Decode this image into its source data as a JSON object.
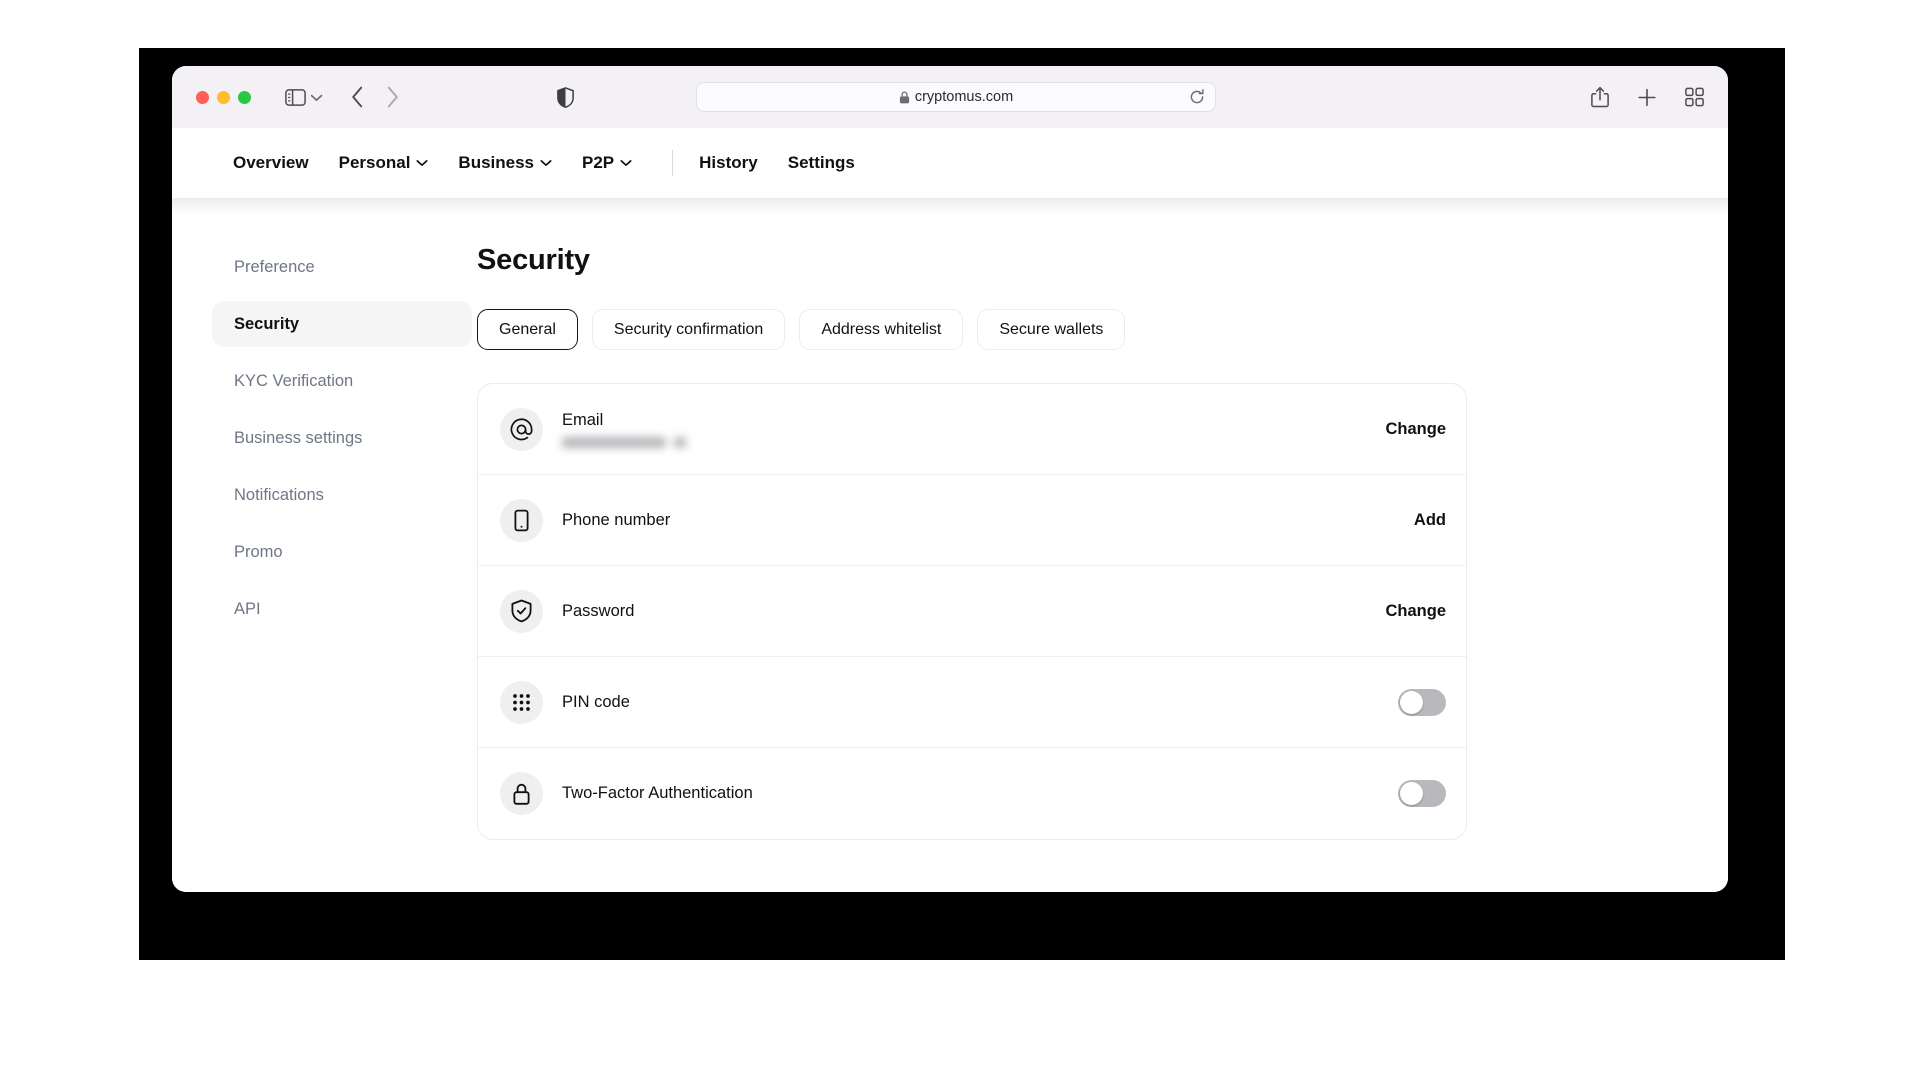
{
  "browser": {
    "traffic_lights": [
      "close",
      "minimize",
      "maximize"
    ],
    "url": "cryptomus.com",
    "lock_icon": "lock-icon",
    "sidebar_icon": "sidebar-toggle-icon",
    "tabgroup_caret_icon": "chevron-down-icon",
    "back_icon": "chevron-left-icon",
    "forward_icon": "chevron-right-icon",
    "shield_icon": "privacy-shield-icon",
    "reload_icon": "reload-icon",
    "share_icon": "share-icon",
    "new_tab_icon": "plus-icon",
    "tab_overview_icon": "tab-overview-icon"
  },
  "site_nav": {
    "items": [
      {
        "label": "Overview",
        "has_caret": false
      },
      {
        "label": "Personal",
        "has_caret": true
      },
      {
        "label": "Business",
        "has_caret": true
      },
      {
        "label": "P2P",
        "has_caret": true
      }
    ],
    "items_right": [
      {
        "label": "History",
        "has_caret": false
      },
      {
        "label": "Settings",
        "has_caret": false
      }
    ]
  },
  "sidebar": {
    "items": [
      {
        "label": "Preference",
        "active": false
      },
      {
        "label": "Security",
        "active": true
      },
      {
        "label": "KYC Verification",
        "active": false
      },
      {
        "label": "Business settings",
        "active": false
      },
      {
        "label": "Notifications",
        "active": false
      },
      {
        "label": "Promo",
        "active": false
      },
      {
        "label": "API",
        "active": false
      }
    ]
  },
  "main": {
    "title": "Security",
    "tabs": [
      {
        "label": "General",
        "active": true
      },
      {
        "label": "Security confirmation",
        "active": false
      },
      {
        "label": "Address whitelist",
        "active": false
      },
      {
        "label": "Secure wallets",
        "active": false
      }
    ],
    "rows": [
      {
        "label": "Email",
        "icon": "at-sign-icon",
        "action": "Change",
        "control": "link",
        "value_redacted": true
      },
      {
        "label": "Phone number",
        "icon": "phone-icon",
        "action": "Add",
        "control": "link",
        "value_redacted": false
      },
      {
        "label": "Password",
        "icon": "shield-check-icon",
        "action": "Change",
        "control": "link",
        "value_redacted": false
      },
      {
        "label": "PIN code",
        "icon": "keypad-dots-icon",
        "action": "",
        "control": "toggle",
        "toggle_on": false
      },
      {
        "label": "Two-Factor Authentication",
        "icon": "padlock-icon",
        "action": "",
        "control": "toggle",
        "toggle_on": false
      }
    ]
  },
  "colors": {
    "accent_dark": "#111114",
    "toolbar_bg": "#f4f1f6",
    "sidebar_active_bg": "#f5f5f6",
    "card_border": "#ececee",
    "toggle_off": "#b9b9bd",
    "muted_text": "#6e7686"
  }
}
